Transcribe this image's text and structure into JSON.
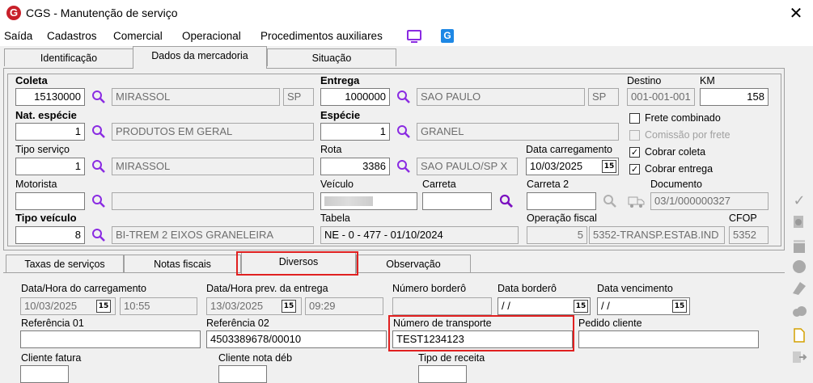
{
  "window": {
    "title": "CGS - Manutenção de serviço",
    "close": "✕",
    "app_icon": "G"
  },
  "menu": [
    "Saída",
    "Cadastros",
    "Comercial",
    "Operacional",
    "Procedimentos auxiliares"
  ],
  "tabs": [
    "Identificação",
    "Dados da mercadoria",
    "Situação"
  ],
  "form": {
    "coleta": {
      "label": "Coleta",
      "code": "15130000",
      "city": "MIRASSOL",
      "uf": "SP"
    },
    "entrega": {
      "label": "Entrega",
      "code": "1000000",
      "city": "SAO PAULO",
      "uf": "SP"
    },
    "destino": {
      "label": "Destino",
      "value": "001-001-001"
    },
    "km": {
      "label": "KM",
      "value": "158"
    },
    "nat_especie": {
      "label": "Nat. espécie",
      "code": "1",
      "desc": "PRODUTOS EM GERAL"
    },
    "especie": {
      "label": "Espécie",
      "code": "1",
      "desc": "GRANEL"
    },
    "frete_combinado": "Frete combinado",
    "comissao_por_frete": "Comissão por frete",
    "tipo_servico": {
      "label": "Tipo serviço",
      "code": "1",
      "desc": "MIRASSOL"
    },
    "rota": {
      "label": "Rota",
      "code": "3386",
      "desc": "SAO PAULO/SP X"
    },
    "data_carregamento": {
      "label": "Data carregamento",
      "value": "10/03/2025"
    },
    "cobrar_coleta": "Cobrar coleta",
    "cobrar_entrega": "Cobrar entrega",
    "motorista": {
      "label": "Motorista"
    },
    "veiculo": {
      "label": "Veículo"
    },
    "carreta": {
      "label": "Carreta"
    },
    "carreta2": {
      "label": "Carreta 2"
    },
    "documento": {
      "label": "Documento",
      "value": "03/1/000000327"
    },
    "tipo_veiculo": {
      "label": "Tipo veículo",
      "code": "8",
      "desc": "BI-TREM 2 EIXOS GRANELEIRA"
    },
    "tabela": {
      "label": "Tabela",
      "value": "NE - 0 - 477 - 01/10/2024"
    },
    "operacao_fiscal": {
      "label": "Operação fiscal",
      "code": "5",
      "desc": "5352-TRANSP.ESTAB.IND"
    },
    "cfop": {
      "label": "CFOP",
      "value": "5352"
    }
  },
  "subtabs": [
    "Taxas de serviços",
    "Notas fiscais",
    "Diversos",
    "Observação"
  ],
  "diversos": {
    "data_hora_carregamento": {
      "label": "Data/Hora do carregamento",
      "date": "10/03/2025",
      "time": "10:55"
    },
    "data_hora_prev_entrega": {
      "label": "Data/Hora prev. da entrega",
      "date": "13/03/2025",
      "time": "09:29"
    },
    "numero_bordero": {
      "label": "Número borderô"
    },
    "data_bordero": {
      "label": "Data borderô",
      "value": " / /"
    },
    "data_vencimento": {
      "label": "Data vencimento",
      "value": " / /"
    },
    "referencia_01": {
      "label": "Referência 01",
      "value": ""
    },
    "referencia_02": {
      "label": "Referência 02",
      "value": "4503389678/00010"
    },
    "numero_transporte": {
      "label": "Número de transporte",
      "value": "TEST1234123"
    },
    "pedido_cliente": {
      "label": "Pedido cliente",
      "value": ""
    },
    "cliente_fatura": {
      "label": "Cliente fatura"
    },
    "cliente_nota_deb": {
      "label": "Cliente nota déb"
    },
    "tipo_receita": {
      "label": "Tipo de receita"
    }
  },
  "calendar_glyph": "15",
  "check_mark": "✓",
  "colors": {
    "accent": "#e02020",
    "lookup": "#8a2be2"
  }
}
